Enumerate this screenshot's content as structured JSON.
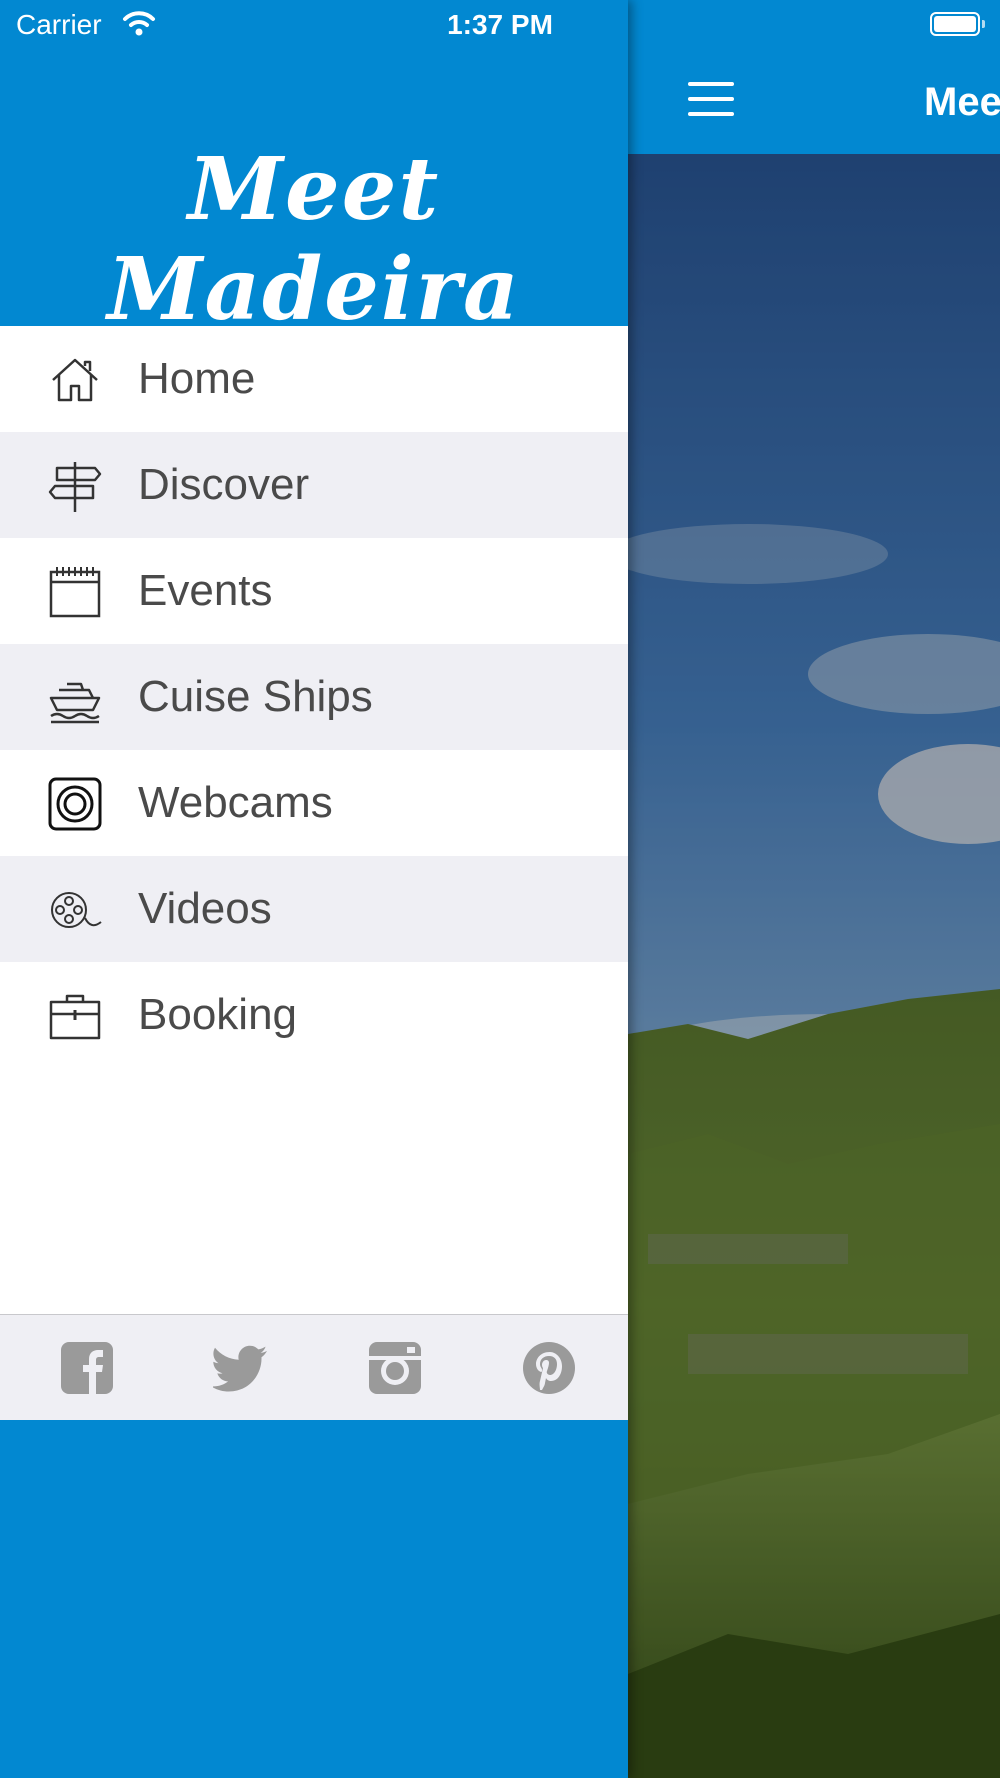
{
  "status_bar": {
    "carrier": "Carrier",
    "time": "1:37 PM"
  },
  "drawer": {
    "logo_text": "Meet Madeira",
    "menu": [
      {
        "label": "Home",
        "icon": "home-icon"
      },
      {
        "label": "Discover",
        "icon": "signpost-icon"
      },
      {
        "label": "Events",
        "icon": "calendar-icon"
      },
      {
        "label": "Cuise Ships",
        "icon": "cruise-ship-icon"
      },
      {
        "label": "Webcams",
        "icon": "webcam-icon"
      },
      {
        "label": "Videos",
        "icon": "film-reel-icon"
      },
      {
        "label": "Booking",
        "icon": "briefcase-icon"
      }
    ],
    "social": [
      "facebook-icon",
      "twitter-icon",
      "instagram-icon",
      "pinterest-icon"
    ]
  },
  "main": {
    "title": "Mee",
    "menu_icon": "hamburger-icon"
  },
  "colors": {
    "brand_blue": "#0288d1",
    "menu_alt_row": "#efeff4",
    "menu_text": "#4a4a4a",
    "social_gray": "#9a9a9a"
  }
}
